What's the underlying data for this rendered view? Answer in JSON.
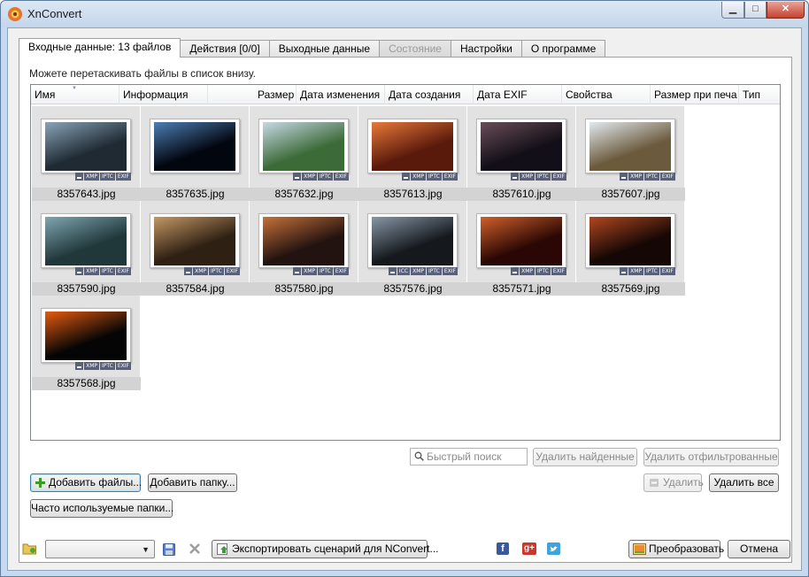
{
  "window": {
    "title": "XnConvert",
    "minimize_glyph": "▁",
    "maximize_glyph": "□",
    "close_glyph": "✕"
  },
  "tabs": [
    {
      "label": "Входные данные: 13 файлов",
      "active": true
    },
    {
      "label": "Действия [0/0]"
    },
    {
      "label": "Выходные данные"
    },
    {
      "label": "Состояние",
      "disabled": true
    },
    {
      "label": "Настройки"
    },
    {
      "label": "О программе"
    }
  ],
  "input": {
    "hint": "Можете перетаскивать файлы в список внизу.",
    "columns": [
      "Имя",
      "Информация",
      "Размер",
      "Дата изменения",
      "Дата создания",
      "Дата EXIF",
      "Свойства",
      "Размер при печа",
      "Тип"
    ],
    "files": [
      {
        "name": "8357643.jpg",
        "badges": [
          "XMP",
          "IPTC",
          "EXIF"
        ]
      },
      {
        "name": "8357635.jpg",
        "badges": []
      },
      {
        "name": "8357632.jpg",
        "badges": [
          "XMP",
          "IPTC",
          "EXIF"
        ]
      },
      {
        "name": "8357613.jpg",
        "badges": [
          "XMP",
          "IPTC",
          "EXIF"
        ]
      },
      {
        "name": "8357610.jpg",
        "badges": [
          "XMP",
          "IPTC",
          "EXIF"
        ]
      },
      {
        "name": "8357607.jpg",
        "badges": [
          "XMP",
          "IPTC",
          "EXIF"
        ]
      },
      {
        "name": "8357590.jpg",
        "badges": [
          "XMP",
          "IPTC",
          "EXIF"
        ]
      },
      {
        "name": "8357584.jpg",
        "badges": [
          "XMP",
          "IPTC",
          "EXIF"
        ]
      },
      {
        "name": "8357580.jpg",
        "badges": [
          "XMP",
          "IPTC",
          "EXIF"
        ]
      },
      {
        "name": "8357576.jpg",
        "badges": [
          "ICC",
          "XMP",
          "IPTC",
          "EXIF"
        ]
      },
      {
        "name": "8357571.jpg",
        "badges": [
          "XMP",
          "IPTC",
          "EXIF"
        ]
      },
      {
        "name": "8357569.jpg",
        "badges": [
          "XMP",
          "IPTC",
          "EXIF"
        ]
      },
      {
        "name": "8357568.jpg",
        "badges": [
          "XMP",
          "IPTC",
          "EXIF"
        ]
      }
    ],
    "search_placeholder": "Быстрый поиск",
    "remove_found": "Удалить найденные",
    "remove_filtered": "Удалить отфильтрованные",
    "add_files": "Добавить файлы...",
    "add_folder": "Добавить папку...",
    "remove": "Удалить",
    "remove_all": "Удалить все",
    "frequent_folders": "Часто используемые папки..."
  },
  "footer": {
    "export_script": "Экспортировать сценарий для NConvert...",
    "convert": "Преобразовать",
    "cancel": "Отмена",
    "facebook": "f",
    "googleplus": "g+"
  },
  "thumb_colors": [
    [
      "#1f2a33",
      "#8aa4b8"
    ],
    [
      "#02060f",
      "#4d7fb5"
    ],
    [
      "#3d6b38",
      "#c7d9e6"
    ],
    [
      "#5a1a0b",
      "#e8793a"
    ],
    [
      "#120f18",
      "#6a4d57"
    ],
    [
      "#6b5a3c",
      "#e3e9ef"
    ],
    [
      "#20383a",
      "#7fa6b2"
    ],
    [
      "#2e2013",
      "#c49865"
    ],
    [
      "#231310",
      "#c7713a"
    ],
    [
      "#15191e",
      "#8897a6"
    ],
    [
      "#2a0704",
      "#d0602a"
    ],
    [
      "#140705",
      "#b2471f"
    ],
    [
      "#050505",
      "#e55b10"
    ]
  ]
}
